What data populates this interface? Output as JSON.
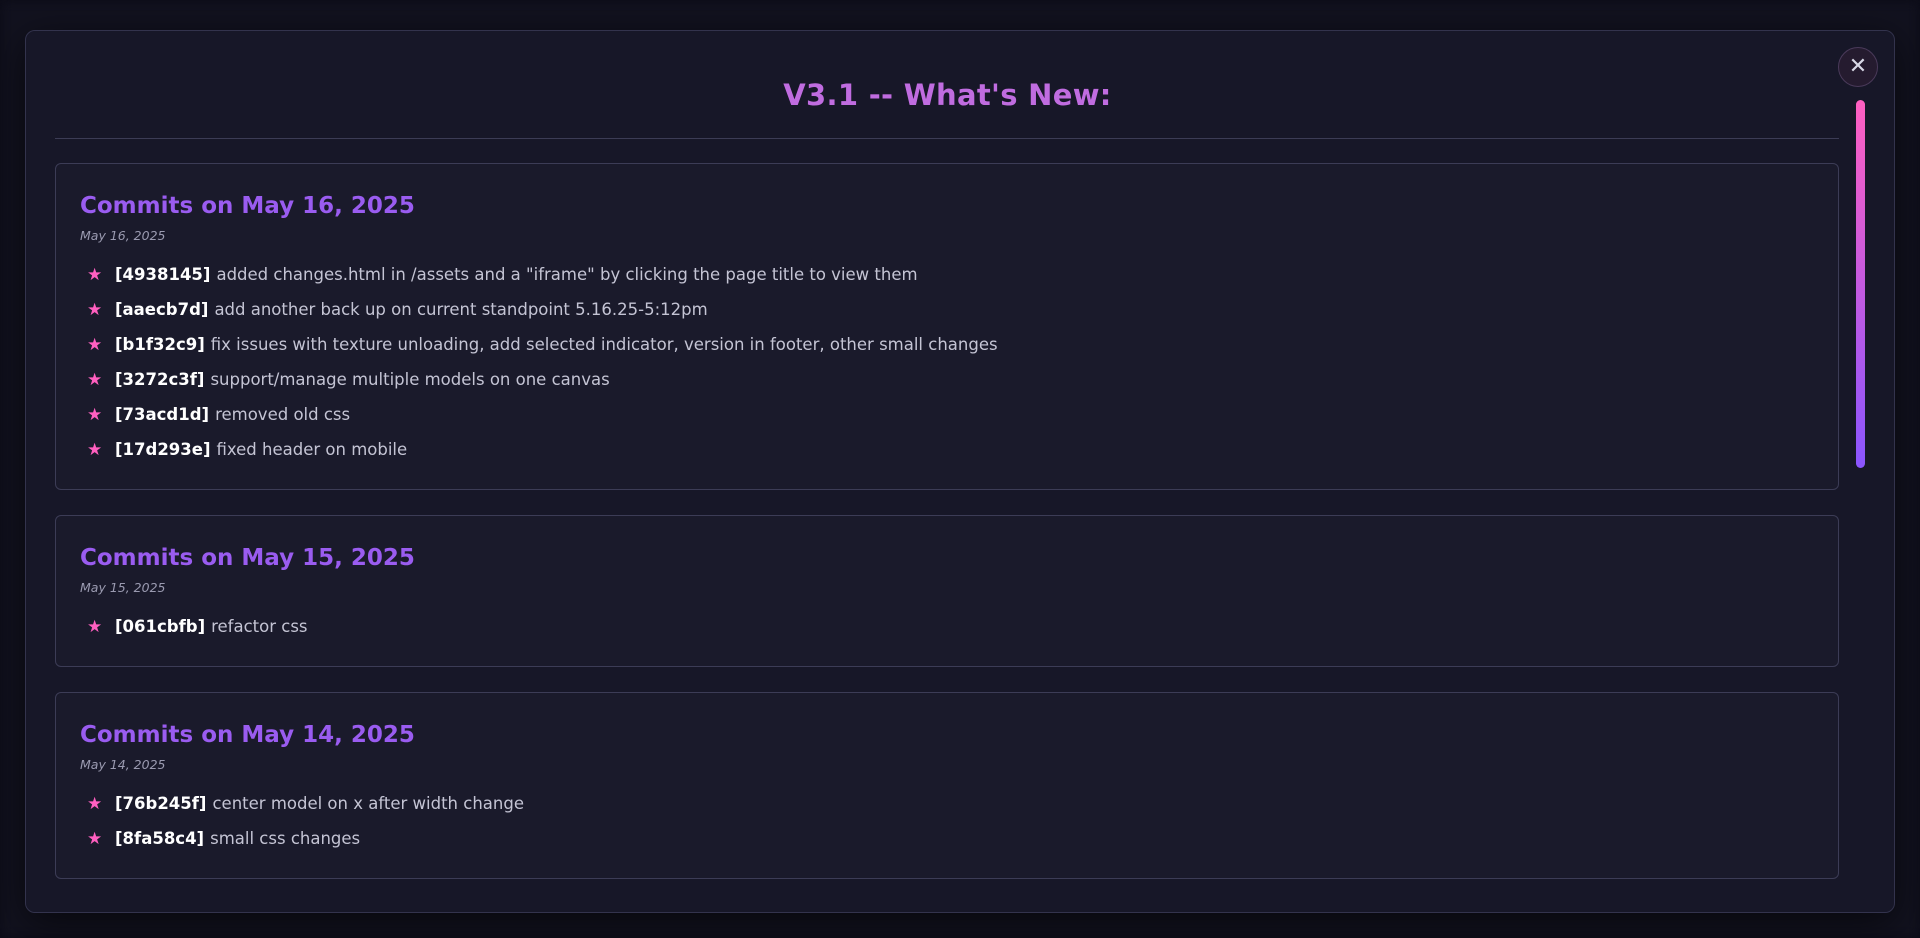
{
  "modal": {
    "title": "V3.1 -- What's New:",
    "close_label": "✕"
  },
  "colors": {
    "title": "#c06ce0",
    "card_title": "#9a5cf0",
    "star": "#ff5fc0",
    "scroll_gradient_top": "#ff5fc0",
    "scroll_gradient_bottom": "#8a55ff"
  },
  "scroll": {
    "thumb_fraction": 0.46
  },
  "commit_groups": [
    {
      "heading": "Commits on May 16, 2025",
      "date": "May 16, 2025",
      "commits": [
        {
          "hash": "[4938145]",
          "message": "added changes.html in /assets and a \"iframe\" by clicking the page title to view them"
        },
        {
          "hash": "[aaecb7d]",
          "message": "add another back up on current standpoint 5.16.25-5:12pm"
        },
        {
          "hash": "[b1f32c9]",
          "message": "fix issues with texture unloading, add selected indicator, version in footer, other small changes"
        },
        {
          "hash": "[3272c3f]",
          "message": "support/manage multiple models on one canvas"
        },
        {
          "hash": "[73acd1d]",
          "message": "removed old css"
        },
        {
          "hash": "[17d293e]",
          "message": "fixed header on mobile"
        }
      ]
    },
    {
      "heading": "Commits on May 15, 2025",
      "date": "May 15, 2025",
      "commits": [
        {
          "hash": "[061cbfb]",
          "message": "refactor css"
        }
      ]
    },
    {
      "heading": "Commits on May 14, 2025",
      "date": "May 14, 2025",
      "commits": [
        {
          "hash": "[76b245f]",
          "message": "center model on x after width change"
        },
        {
          "hash": "[8fa58c4]",
          "message": "small css changes"
        }
      ]
    }
  ]
}
